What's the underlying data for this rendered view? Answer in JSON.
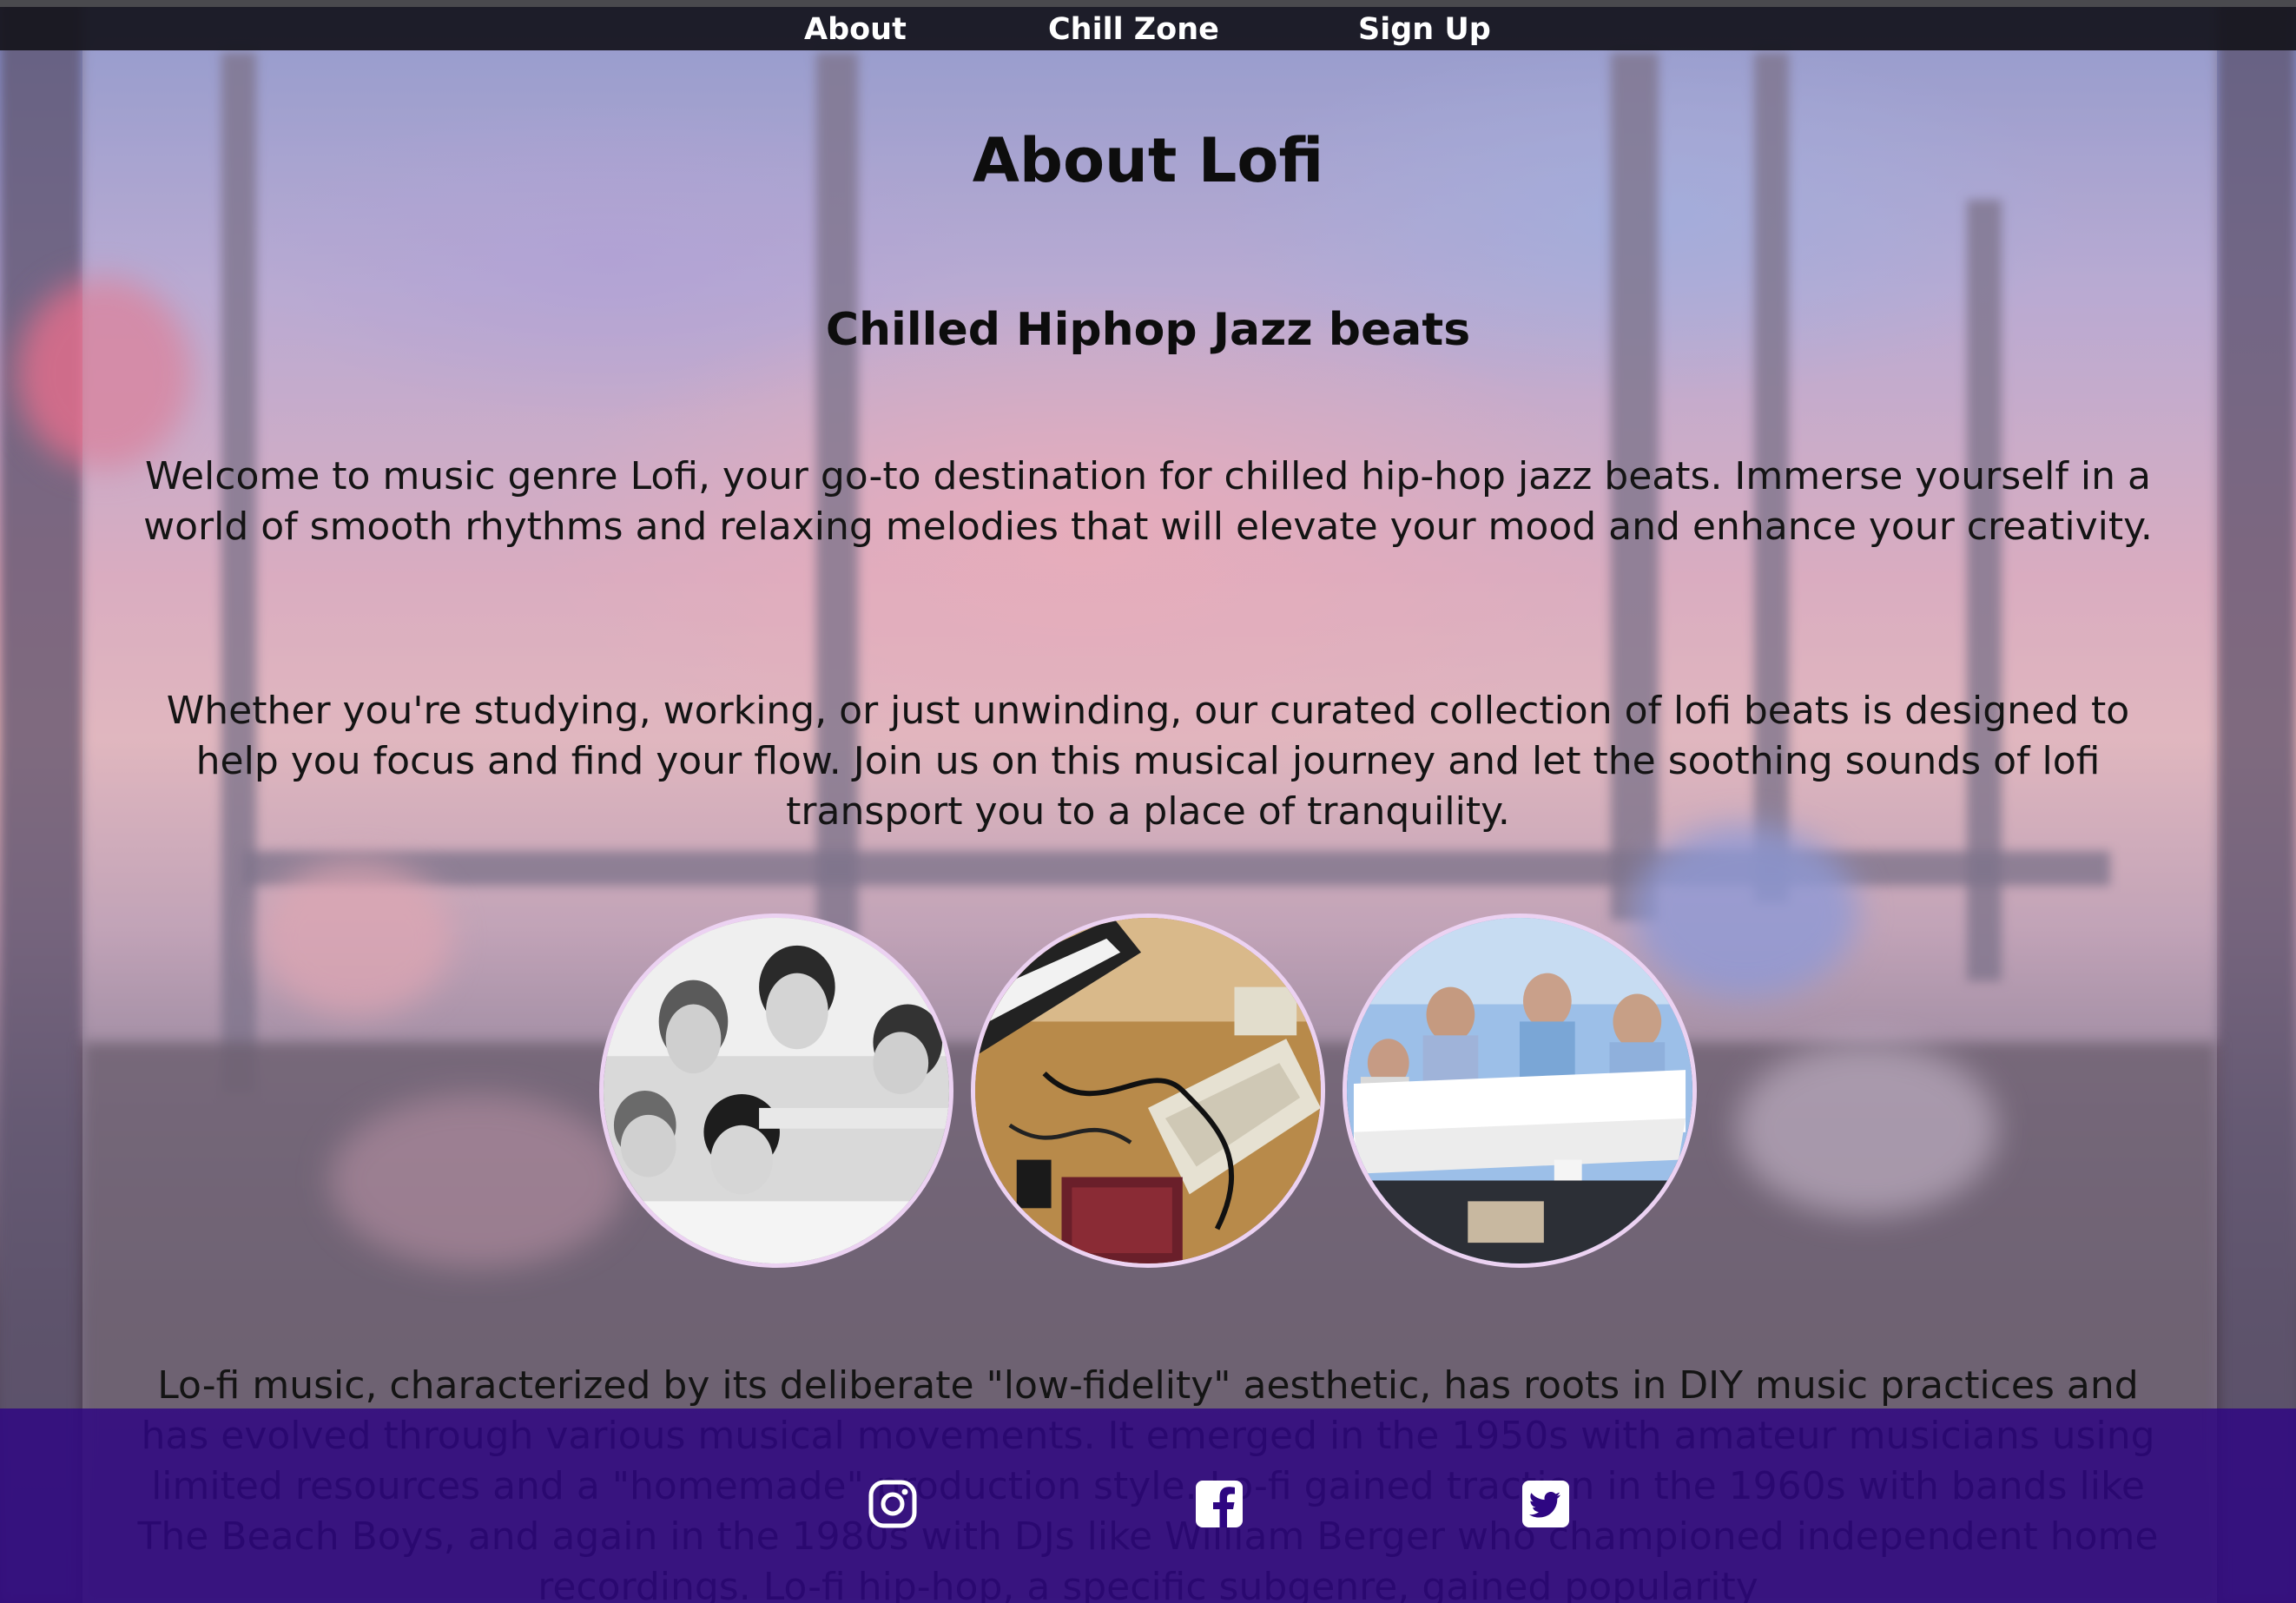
{
  "nav": {
    "links": [
      "About",
      "Chill Zone",
      "Sign Up"
    ]
  },
  "page": {
    "title": "About Lofi",
    "subtitle": "Chilled Hiphop Jazz beats",
    "paragraphs": [
      "Welcome to music genre Lofi, your go-to destination for chilled hip-hop jazz beats. Immerse yourself in a world of smooth rhythms and relaxing melodies that will elevate your mood and enhance your creativity.",
      "Whether you're studying, working, or just unwinding, our curated collection of lofi beats is designed to help you focus and find your flow. Join us on this musical journey and let the soothing sounds of lofi transport you to a place of tranquility.",
      "Lo-fi music, characterized by its deliberate \"low-fidelity\" aesthetic, has roots in DIY music practices and has evolved through various musical movements. It emerged in the 1950s with amateur musicians using limited resources and a \"homemade\" production style. Lo-fi gained traction in the 1960s with bands like The Beach Boys, and again in the 1980s with DJs like William Berger who championed independent home recordings. Lo-fi hip-hop, a specific subgenre, gained popularity"
    ]
  },
  "gallery": [
    {
      "name": "band-portrait-photo"
    },
    {
      "name": "keyboard-studio-photo"
    },
    {
      "name": "piano-performance-photo"
    }
  ],
  "footer": {
    "icons": [
      "instagram-icon",
      "facebook-icon",
      "twitter-icon"
    ]
  },
  "colors": {
    "navbar": "#16141c",
    "footer": "#2e0682",
    "photo_border": "#ecd2f2",
    "text": "#141414"
  }
}
